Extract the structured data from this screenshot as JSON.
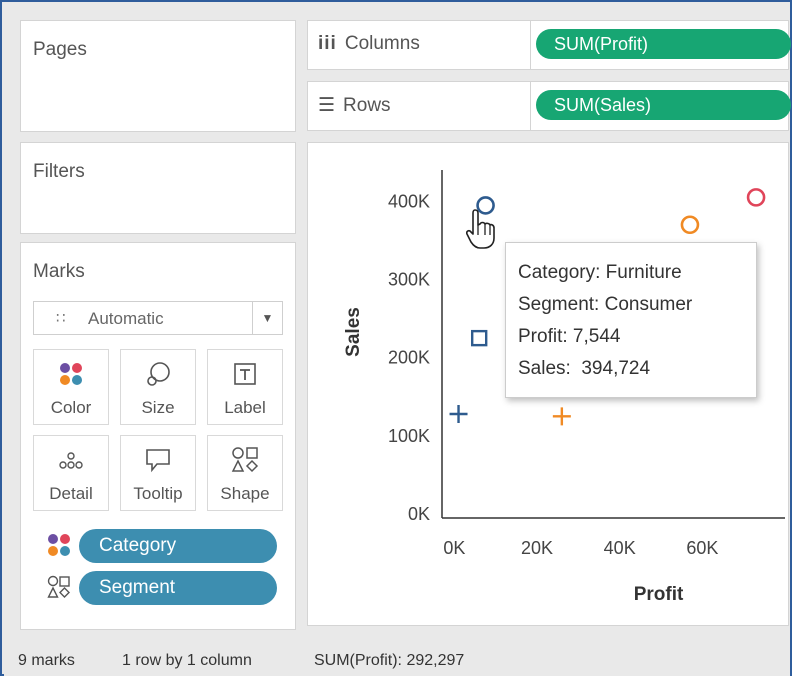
{
  "pages": {
    "title": "Pages"
  },
  "filters": {
    "title": "Filters"
  },
  "marks": {
    "title": "Marks",
    "mark_type": "Automatic",
    "mark_type_icon": "automatic-marks-icon",
    "buttons": [
      {
        "label": "Color",
        "icon": "color-icon"
      },
      {
        "label": "Size",
        "icon": "size-icon"
      },
      {
        "label": "Label",
        "icon": "label-icon"
      },
      {
        "label": "Detail",
        "icon": "detail-icon"
      },
      {
        "label": "Tooltip",
        "icon": "tooltip-icon"
      },
      {
        "label": "Shape",
        "icon": "shape-icon"
      }
    ],
    "fields": [
      {
        "label": "Category",
        "encoding": "color"
      },
      {
        "label": "Segment",
        "encoding": "shape"
      }
    ]
  },
  "shelves": {
    "columns": {
      "label": "Columns",
      "pill": "SUM(Profit)"
    },
    "rows": {
      "label": "Rows",
      "pill": "SUM(Sales)"
    }
  },
  "colors": {
    "pill_measure": "#17a673",
    "pill_dimension": "#3d8eb0",
    "furniture": "#2e5b8e",
    "office_supplies": "#f08a24",
    "technology": "#e0455a"
  },
  "tooltip": {
    "line1": "Category: Furniture",
    "line2": "Segment: Consumer",
    "line3": "Profit: 7,544",
    "line4": "Sales:  394,724"
  },
  "status": {
    "marks": "9 marks",
    "layout": "1 row by 1 column",
    "sum": "SUM(Profit): 292,297"
  },
  "chart_data": {
    "type": "scatter",
    "xlabel": "Profit",
    "ylabel": "Sales",
    "x_ticks": [
      "0K",
      "20K",
      "40K",
      "60K"
    ],
    "x_tick_values": [
      0,
      20000,
      40000,
      60000
    ],
    "y_ticks": [
      "0K",
      "100K",
      "200K",
      "300K",
      "400K"
    ],
    "y_tick_values": [
      0,
      100000,
      200000,
      300000,
      400000
    ],
    "xlim": [
      -3000,
      80000
    ],
    "ylim": [
      -5000,
      440000
    ],
    "points": [
      {
        "x": 7544,
        "y": 394724,
        "shape": "circle",
        "color": "#2e5b8e"
      },
      {
        "x": 6000,
        "y": 225000,
        "shape": "square",
        "color": "#2e5b8e"
      },
      {
        "x": 1000,
        "y": 128000,
        "shape": "plus",
        "color": "#2e5b8e"
      },
      {
        "x": 57000,
        "y": 370000,
        "shape": "circle",
        "color": "#f08a24"
      },
      {
        "x": 26000,
        "y": 125000,
        "shape": "plus",
        "color": "#f08a24"
      },
      {
        "x": 73000,
        "y": 405000,
        "shape": "circle",
        "color": "#e0455a"
      }
    ]
  }
}
